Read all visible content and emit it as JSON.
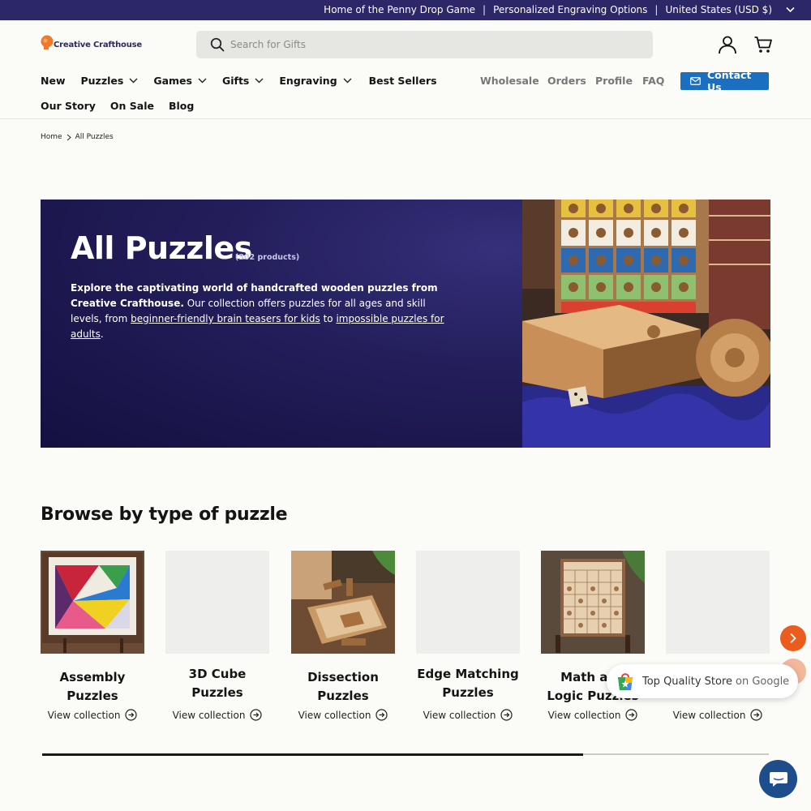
{
  "announcement": {
    "link1": "Home of the Penny Drop Game",
    "link2": "Personalized Engraving Options",
    "currency": "United States (USD $)",
    "separator": "|"
  },
  "header": {
    "brand": "Creative Crafthouse",
    "search_placeholder": "Search for Gifts"
  },
  "nav": {
    "primary": [
      "New",
      "Puzzles",
      "Games",
      "Gifts",
      "Engraving",
      "Best Sellers"
    ],
    "secondary": [
      "Our Story",
      "On Sale",
      "Blog"
    ],
    "utility": [
      "Wholesale",
      "Orders",
      "Profile",
      "FAQ"
    ],
    "contact": "Contact Us"
  },
  "breadcrumb": {
    "home": "Home",
    "current": "All Puzzles"
  },
  "hero": {
    "title": "All Puzzles",
    "count": "(302 products)",
    "desc_bold": "Explore the captivating world of handcrafted wooden puzzles from Creative Crafthouse.",
    "desc_mid": " Our collection offers puzzles for all ages and skill levels, from ",
    "link_kids": "beginner-friendly brain teasers for kids",
    "desc_to": " to ",
    "link_adults": "impossible puzzles for adults",
    "desc_end": "."
  },
  "browse": {
    "title": "Browse by type of puzzle",
    "view_label": "View collection",
    "cards": [
      {
        "title": "Assembly Puzzles"
      },
      {
        "title": "3D Cube Puzzles"
      },
      {
        "title": "Dissection Puzzles"
      },
      {
        "title": "Edge Matching Puzzles"
      },
      {
        "title": "Math and Logic Puzzles"
      },
      {
        "title": ""
      }
    ],
    "scroll_progress": 0.744
  },
  "google_badge": {
    "text": "Top Quality Store",
    "suffix": "on Google"
  },
  "colors": {
    "announcement_bg": "#2c2868",
    "contact_bg": "#1a6fc1",
    "accent_orange": "#ec5c1f",
    "chat_bg": "#1e4d8c"
  }
}
